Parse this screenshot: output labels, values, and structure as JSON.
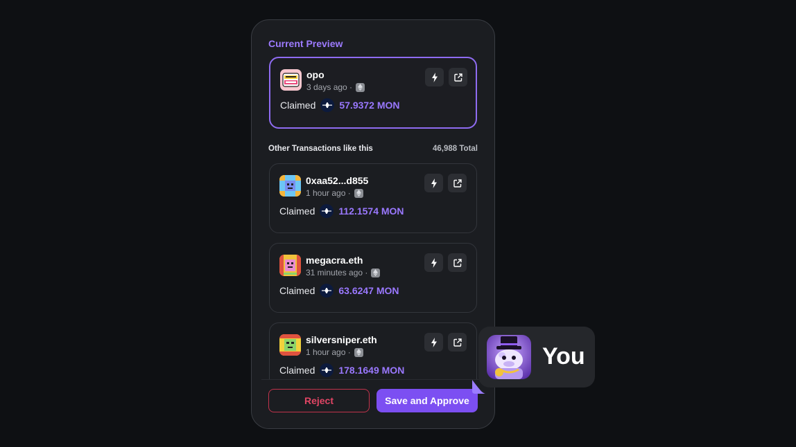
{
  "preview": {
    "title": "Current Preview",
    "card": {
      "name": "opo",
      "time": "3 days ago ·",
      "claimed_label": "Claimed",
      "amount": "57.9372 MON"
    }
  },
  "others": {
    "title": "Other Transactions like this",
    "total": "46,988 Total",
    "items": [
      {
        "name": "0xaa52...d855",
        "time": "1 hour ago ·",
        "claimed_label": "Claimed",
        "amount": "112.1574 MON"
      },
      {
        "name": "megacra.eth",
        "time": "31 minutes ago ·",
        "claimed_label": "Claimed",
        "amount": "63.6247 MON"
      },
      {
        "name": "silversniper.eth",
        "time": "1 hour ago ·",
        "claimed_label": "Claimed",
        "amount": "178.1649 MON"
      }
    ]
  },
  "actions": {
    "reject": "Reject",
    "approve": "Save and Approve"
  },
  "user": {
    "label": "You"
  },
  "icons": {
    "lightning": "lightning-icon",
    "external": "external-link-icon",
    "chain": "ethereum-icon",
    "token": "monad-icon"
  },
  "colors": {
    "accent": "#8f6cf2",
    "amount": "#9a78ff",
    "reject": "#e04564",
    "approve": "#7c4ff2",
    "background": "#0e1013",
    "panel": "#1b1d21"
  }
}
